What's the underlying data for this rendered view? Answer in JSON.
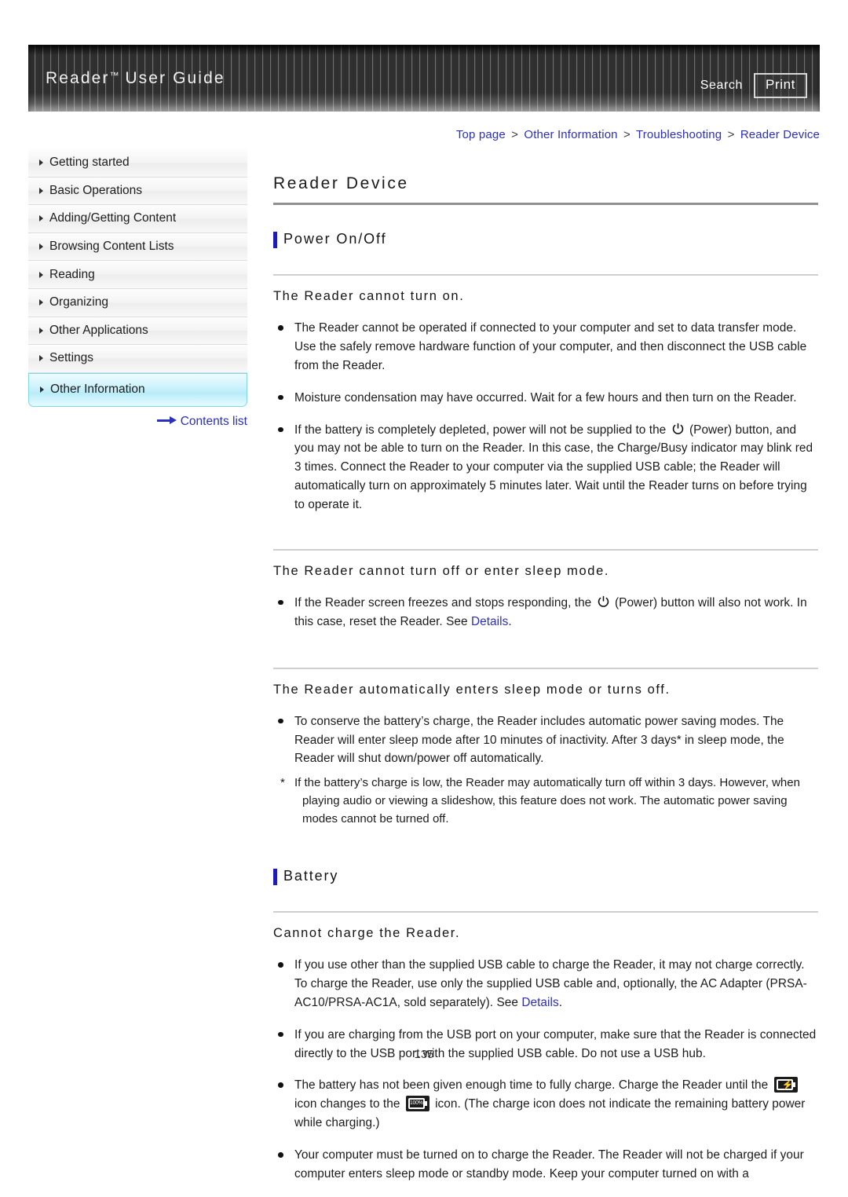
{
  "header": {
    "title_main": "Reader",
    "title_tm": "™",
    "title_rest": " User Guide",
    "search_label": "Search",
    "print_label": "Print"
  },
  "breadcrumb": {
    "items": [
      "Top page",
      "Other Information",
      "Troubleshooting",
      "Reader Device"
    ],
    "separator": ">"
  },
  "sidebar": {
    "items": [
      {
        "label": "Getting started",
        "active": false
      },
      {
        "label": "Basic Operations",
        "active": false
      },
      {
        "label": "Adding/Getting Content",
        "active": false
      },
      {
        "label": "Browsing Content Lists",
        "active": false
      },
      {
        "label": "Reading",
        "active": false
      },
      {
        "label": "Organizing",
        "active": false
      },
      {
        "label": "Other Applications",
        "active": false
      },
      {
        "label": "Settings",
        "active": false
      },
      {
        "label": "Other Information",
        "active": true
      }
    ],
    "contents_link": "Contents list"
  },
  "main": {
    "page_title": "Reader Device",
    "sections": [
      {
        "heading": "Power On/Off",
        "subsections": [
          {
            "title": "The Reader cannot turn on.",
            "bullets": [
              "The Reader cannot be operated if connected to your computer and set to data transfer mode. Use the safely remove hardware function of your computer, and then disconnect the USB cable from the Reader.",
              "Moisture condensation may have occurred. Wait for a few hours and then turn on the Reader."
            ],
            "bullet3_pre": "If the battery is completely depleted, power will not be supplied to the ",
            "bullet3_post": " (Power) button, and you may not be able to turn on the Reader. In this case, the Charge/Busy indicator may blink red 3 times. Connect the Reader to your computer via the supplied USB cable; the Reader will automatically turn on approximately 5 minutes later. Wait until the Reader turns on before trying to operate it."
          },
          {
            "title": "The Reader cannot turn off or enter sleep mode.",
            "bullet_pre": "If the Reader screen freezes and stops responding, the ",
            "bullet_mid": " (Power) button will also not work. In this case, reset the Reader. See ",
            "bullet_link": "Details",
            "bullet_post": "."
          },
          {
            "title": "The Reader automatically enters sleep mode or turns off.",
            "bullets": [
              "To conserve the battery’s charge, the Reader includes automatic power saving modes. The Reader will enter sleep mode after 10 minutes of inactivity. After 3 days* in sleep mode, the Reader will shut down/power off automatically."
            ],
            "footnote_star": "*",
            "footnote_line1": "If the battery’s charge is low, the Reader may automatically turn off within 3 days. However, when",
            "footnote_line2": "playing audio or viewing a slideshow, this feature does not work. The automatic power saving modes cannot be turned off."
          }
        ]
      },
      {
        "heading": "Battery",
        "subsections": [
          {
            "title": "Cannot charge the Reader.",
            "bullet1_pre": "If you use other than the supplied USB cable to charge the Reader, it may not charge correctly. To charge the Reader, use only the supplied USB cable and, optionally, the AC Adapter (PRSA-AC10/PRSA-AC1A, sold separately). See ",
            "bullet1_link": "Details",
            "bullet1_post": ".",
            "bullet2": "If you are charging from the USB port on your computer, make sure that the Reader is connected directly to the USB port with the supplied USB cable. Do not use a USB hub.",
            "bullet3_pre": "The battery has not been given enough time to fully charge. Charge the Reader until the ",
            "bullet3_mid": " icon changes to the ",
            "bullet3_post": " icon. (The charge icon does not indicate the remaining battery power while charging.)",
            "bullet4": "Your computer must be turned on to charge the Reader. The Reader will not be charged if your computer enters sleep mode or standby mode. Keep your computer turned on with a"
          }
        ]
      }
    ],
    "icons": {
      "power": "power-icon",
      "battery_charging": "battery-charging-icon",
      "battery_full_label": "100%"
    }
  },
  "footer": {
    "page_number": "135"
  },
  "colors": {
    "link": "#2b2fbb",
    "accent_bar": "#1d1db5",
    "sidebar_active": "#b9ecf8",
    "header_bg": "#333333"
  }
}
